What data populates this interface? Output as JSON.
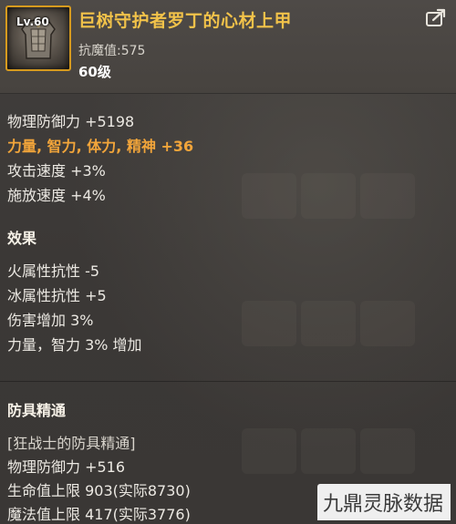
{
  "item": {
    "level_badge": "Lv.60",
    "name": "巨树守护者罗丁的心材上甲",
    "magic_resist": "抗魔值:575",
    "required_level": "60级",
    "frame_color": "#d69a1e",
    "name_color": "#f1c24a"
  },
  "stats": [
    {
      "text": "物理防御力 +5198",
      "highlight": false
    },
    {
      "text": "力量, 智力, 体力, 精神 +36",
      "highlight": true
    },
    {
      "text": "攻击速度 +3%",
      "highlight": false
    },
    {
      "text": "施放速度 +4%",
      "highlight": false
    }
  ],
  "effects": {
    "title": "效果",
    "lines": [
      "火属性抗性 -5",
      "冰属性抗性 +5",
      "伤害增加 3%",
      "力量，智力 3% 增加"
    ]
  },
  "mastery": {
    "title": "防具精通",
    "lines": [
      "[狂战士的防具精通]",
      "物理防御力 +516",
      "生命值上限 903(实际8730)",
      "魔法值上限 417(实际3776)"
    ]
  },
  "icons": {
    "edit": "edit-share-icon",
    "item": "armor-chestplate-icon"
  },
  "watermark": "九鼎灵脉数据",
  "highlight_color": "#f2a53a"
}
